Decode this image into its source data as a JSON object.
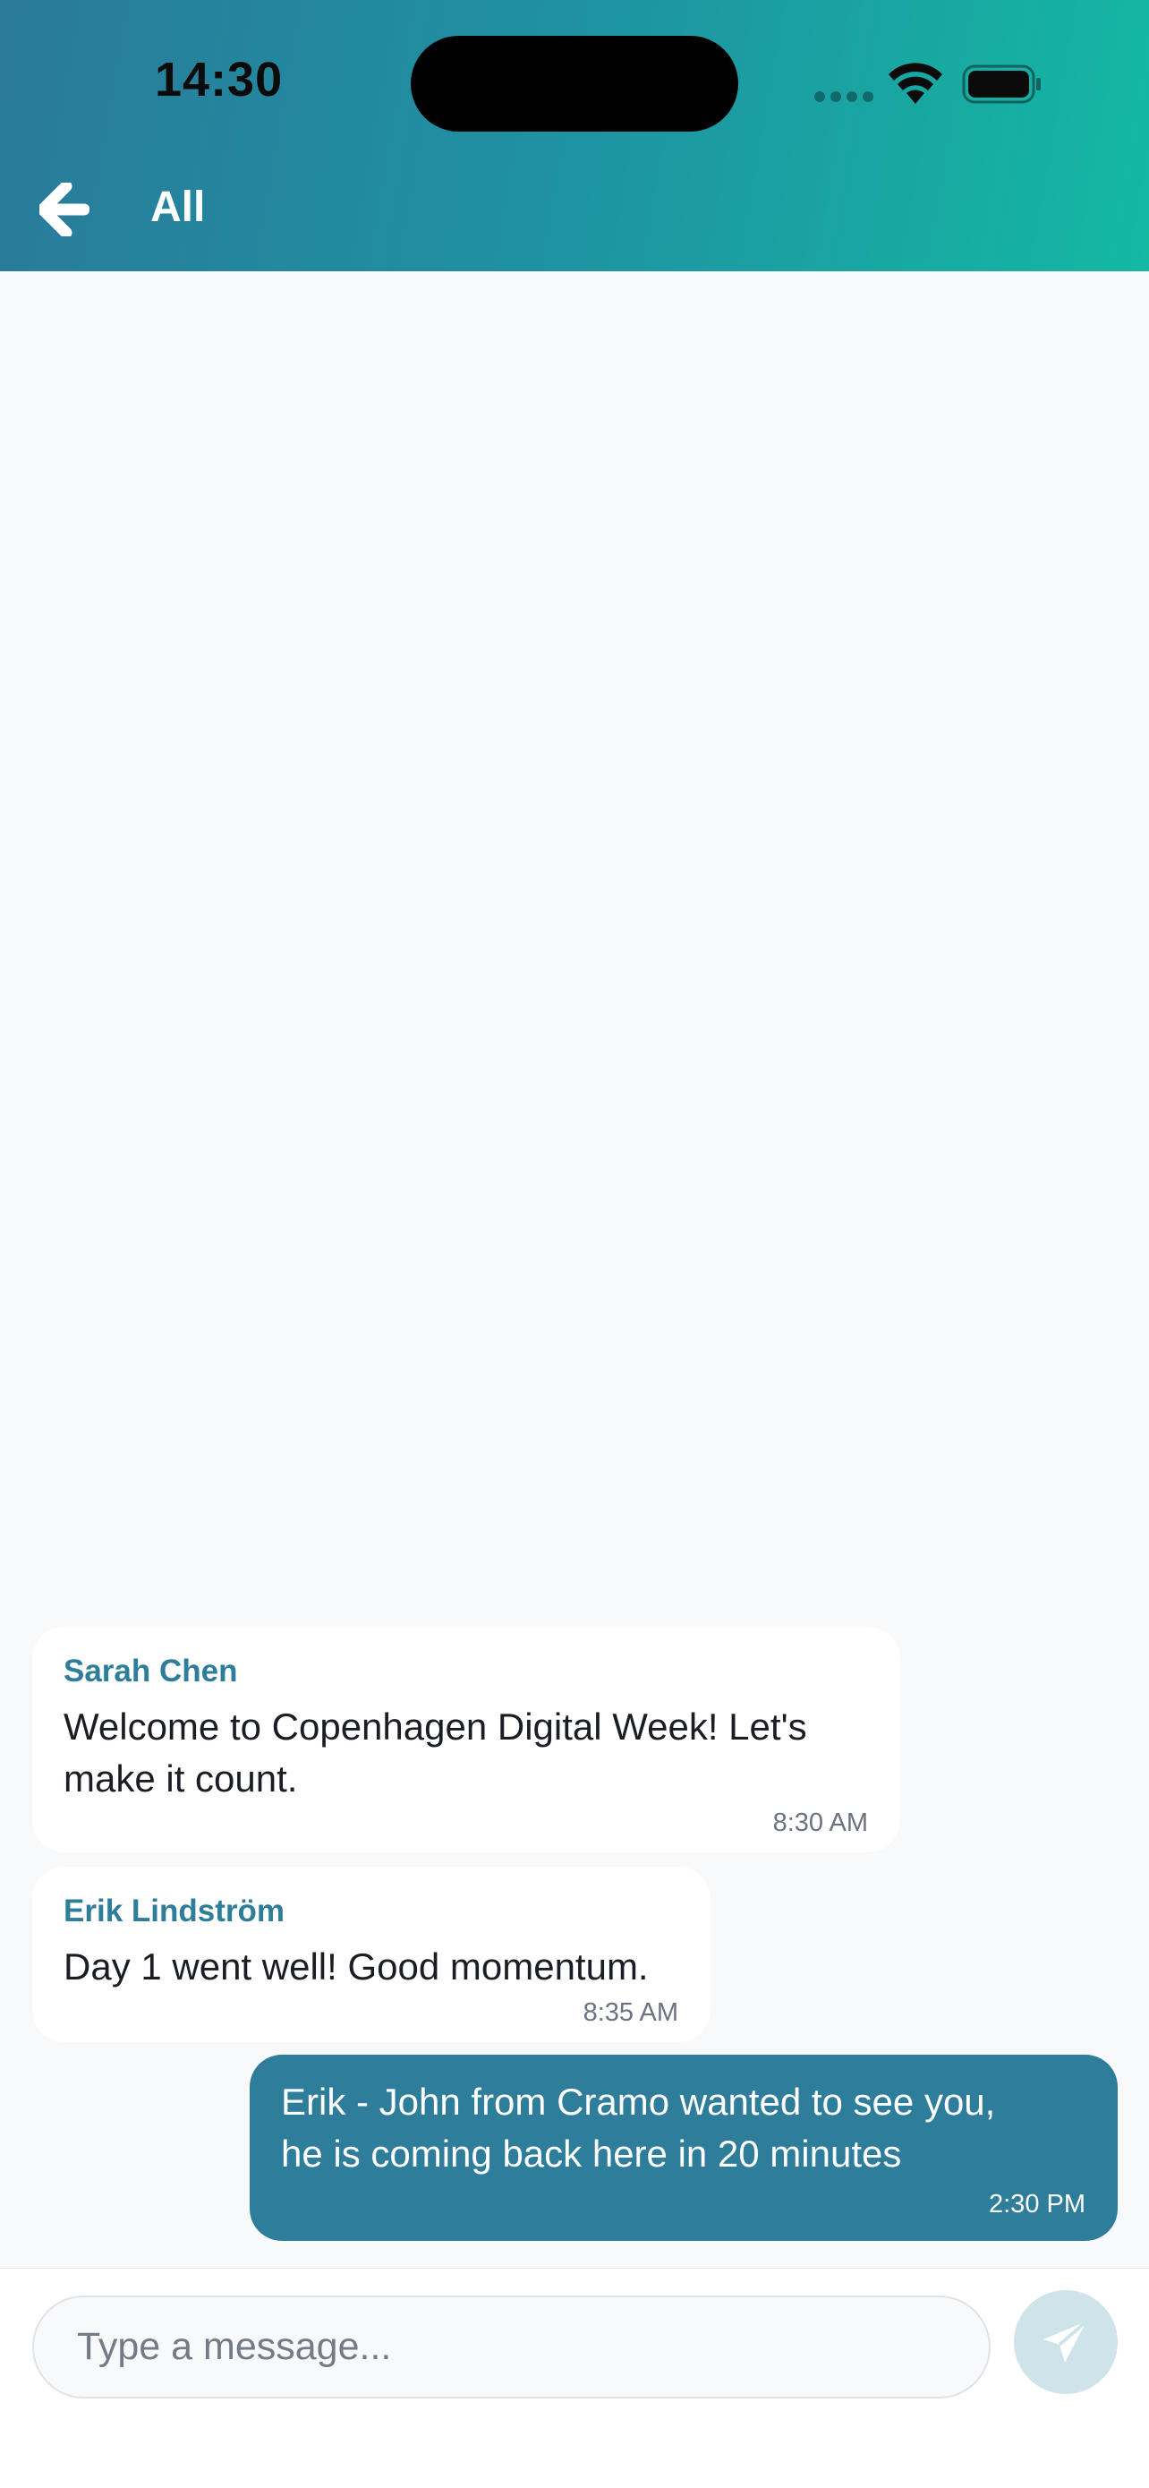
{
  "status_bar": {
    "time": "14:30"
  },
  "header": {
    "back_icon": "arrow-left-icon",
    "title": "All"
  },
  "messages": [
    {
      "sender": "Sarah Chen",
      "text_lines": [
        "Welcome to Copenhagen Digital Week! Let's",
        "make it count."
      ],
      "time": "8:30 AM",
      "own": false
    },
    {
      "sender": "Erik Lindström",
      "text_lines": [
        "Day 1 went well! Good momentum."
      ],
      "time": "8:35 AM",
      "own": false
    },
    {
      "sender": "",
      "text_lines": [
        "Erik - John from Cramo wanted to see you,",
        "he is coming back here in 20 minutes"
      ],
      "time": "2:30 PM",
      "own": true
    }
  ],
  "composer": {
    "placeholder": "Type a message...",
    "value": "",
    "send_icon": "send-icon"
  },
  "colors": {
    "accent": "#2e7d9a",
    "header_gradient_start": "#2a7a9a",
    "header_gradient_end": "#14b8a3",
    "background": "#f8f9fb",
    "send_button_disabled": "#cfe3ea"
  }
}
